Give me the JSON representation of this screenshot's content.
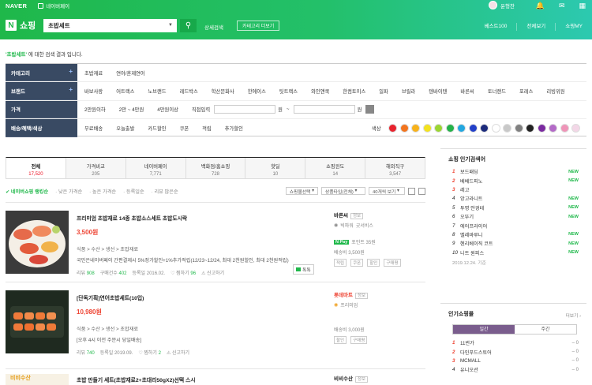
{
  "header": {
    "naver": "NAVER",
    "npay": "네이버페이",
    "user": "윤형찬",
    "logo_n": "N",
    "logo_text": "쇼핑",
    "search_value": "초밥세트",
    "advanced": "상세검색",
    "category_more": "카테고리 더보기",
    "nav": [
      "베스트100",
      "전체보기",
      "쇼핑MY"
    ]
  },
  "result_msg": {
    "keyword": "'초밥세트'",
    "rest": " 에 대한 검색 결과 입니다."
  },
  "filters": {
    "category": {
      "label": "카테고리",
      "values": [
        "초밥재료",
        "연어/훈제연어"
      ]
    },
    "brand": {
      "label": "브랜드",
      "values": [
        "바보사랑",
        "어트랙스",
        "노브랜드",
        "레드박스",
        "학산문화사",
        "한에이스",
        "팃트랙스",
        "와인앤쿡",
        "한컴토이스",
        "일파",
        "브릴라",
        "텐바이텐",
        "바른씨",
        "토너랜드",
        "포레스",
        "리빙위원"
      ]
    },
    "price": {
      "label": "가격",
      "values": [
        "2만원이하",
        "2만 ~ 4만원",
        "4만원이상",
        "직접입력"
      ],
      "won": "원",
      "tilde": "~"
    },
    "delivery": {
      "label": "배송/혜택/색상",
      "values": [
        "무료배송",
        "오늘출발",
        "카드할인",
        "쿠폰",
        "적립",
        "추가할인"
      ],
      "color_label": "색상"
    }
  },
  "color_swatches": [
    "#e8232e",
    "#f2741e",
    "#f7b21c",
    "#f3e21e",
    "#9bd532",
    "#25b24a",
    "#23a7e0",
    "#2240c8",
    "#1c2b7c",
    "#ffffff",
    "#c8c8c8",
    "#808080",
    "#222222",
    "#7a2aa0",
    "#b36ac7",
    "#ef94b8",
    "#f3d7e7"
  ],
  "tabs": [
    {
      "label": "전체",
      "count": "17,520"
    },
    {
      "label": "가격비교",
      "count": "205"
    },
    {
      "label": "네이버페이",
      "count": "7,771"
    },
    {
      "label": "백화점/홈쇼핑",
      "count": "728"
    },
    {
      "label": "핫딜",
      "count": "10"
    },
    {
      "label": "쇼핑윈도",
      "count": "14"
    },
    {
      "label": "해외직구",
      "count": "3,547"
    }
  ],
  "sort": {
    "options": [
      "네이버쇼핑 랭킹순",
      "낮은 가격순",
      "높은 가격순",
      "등록일순",
      "리뷰 많은순"
    ],
    "select1": "쇼핑몰선택",
    "select2": "상품타입(전체)",
    "select3": "40개씩 보기"
  },
  "items": [
    {
      "title": "프리미엄 초밥재료 14종 초밥소스세트 초밥도시락",
      "price": "3,500원",
      "category": "식품 > 수산 > 생선 > 초밥재료",
      "desc": "국민은네이버페이 간편결제시 5%정가할인+1%추가적립(12/23~12/24, 최대 2천원할인, 최대 2천원적립)",
      "review_label": "리뷰",
      "review": "908",
      "buy_label": "구매건수",
      "buy": "402",
      "date": "등록일 2016.02.",
      "wish_label": "찜하기",
      "wish": "96",
      "report": "신고하기",
      "talk": "톡톡",
      "seller": "바른씨",
      "seller_tag": "정보",
      "grade": "빅파워",
      "grade2": "굿서비스",
      "npay_point": "포인트 35원",
      "ship": "배송비 3,500원",
      "tags": [
        "적립",
        "쿠폰",
        "할인",
        "구매평"
      ],
      "thumb_colors": [
        "#3b3b3b",
        "#e66a4a",
        "#f4efe6"
      ]
    },
    {
      "title": "[단독기획]연어초밥세트(10입)",
      "price": "10,980원",
      "category": "식품 > 수산 > 생선 > 초밥재료",
      "desc": "[오후 4시 이전 주문시 당일배송]",
      "review_label": "리뷰",
      "review": "740",
      "date": "등록일 2019.09.",
      "wish_label": "찜하기",
      "wish": "2",
      "report": "신고하기",
      "seller": "롯데마트",
      "seller_tag": "정보",
      "grade": "프리미엄",
      "ship": "배송비 3,000원",
      "tags": [
        "할인",
        "구매평"
      ],
      "thumb_colors": [
        "#1f2a20",
        "#f07a3a",
        "#f3e2cf"
      ]
    },
    {
      "title": "초밥 만들기 세트(초밥재료2+초대리50gX2)선택 스시",
      "thumb_text": "비비수산",
      "seller": "비비수산",
      "seller_tag": "정보"
    }
  ],
  "popular_search": {
    "title": "쇼핑 인기검색어",
    "items": [
      {
        "rank": "1",
        "text": "보드패딩",
        "badge": "NEW"
      },
      {
        "rank": "2",
        "text": "베베드피노",
        "badge": "NEW"
      },
      {
        "rank": "3",
        "text": "레고",
        "badge": ""
      },
      {
        "rank": "4",
        "text": "앙고라니트",
        "badge": "NEW"
      },
      {
        "rank": "5",
        "text": "투명 안경테",
        "badge": "NEW"
      },
      {
        "rank": "6",
        "text": "오뚜기",
        "badge": "NEW"
      },
      {
        "rank": "7",
        "text": "에어프라이어",
        "badge": ""
      },
      {
        "rank": "8",
        "text": "벨레바루니",
        "badge": "NEW"
      },
      {
        "rank": "9",
        "text": "헨리베이직 코트",
        "badge": "NEW"
      },
      {
        "rank": "10",
        "text": "니트 원피스",
        "badge": "NEW"
      }
    ],
    "base": "2019.12.24. 기준"
  },
  "popular_mall": {
    "title": "인기쇼핑몰",
    "more": "더보기",
    "tabs": [
      "일간",
      "주간"
    ],
    "items": [
      {
        "rank": "1",
        "text": "11번가",
        "delta": "0"
      },
      {
        "rank": "2",
        "text": "다인푸드스토어",
        "delta": "0"
      },
      {
        "rank": "3",
        "text": "MCMALL",
        "delta": "0"
      },
      {
        "rank": "4",
        "text": "유니오션",
        "delta": "0"
      }
    ]
  }
}
